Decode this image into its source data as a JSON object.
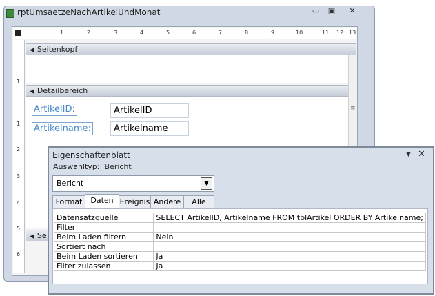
{
  "report_window": {
    "title": "rptUmsaetzeNachArtikelUndMonat",
    "buttons": {
      "minimize": "▭",
      "restore": "▣",
      "close": "✕"
    }
  },
  "ruler": {
    "top_numbers": [
      "1",
      "2",
      "3",
      "4",
      "5",
      "6",
      "7",
      "8",
      "9",
      "10",
      "11",
      "12",
      "13"
    ],
    "left_numbers": [
      "1",
      "1",
      "2",
      "3",
      "4",
      "5",
      "6"
    ]
  },
  "sections": {
    "page_header": "Seitenkopf",
    "detail": "Detailbereich",
    "page_footer_partial": "Se"
  },
  "detail_controls": [
    {
      "label": "ArtikelID:",
      "textbox": "ArtikelID"
    },
    {
      "label": "Artikelname:",
      "textbox": "Artikelname"
    }
  ],
  "property_sheet": {
    "title": "Eigenschaftenblatt",
    "selection_type_label": "Auswahltyp:",
    "selection_type_value": "Bericht",
    "object_combo_value": "Bericht",
    "tabs": [
      "Format",
      "Daten",
      "Ereignis",
      "Andere",
      "Alle"
    ],
    "active_tab": "Daten",
    "rows": [
      {
        "key": "Datensatzquelle",
        "value": "SELECT ArtikelID, Artikelname FROM tblArtikel ORDER BY Artikelname;"
      },
      {
        "key": "Filter",
        "value": ""
      },
      {
        "key": "Beim Laden filtern",
        "value": "Nein"
      },
      {
        "key": "Sortiert nach",
        "value": ""
      },
      {
        "key": "Beim Laden sortieren",
        "value": "Ja"
      },
      {
        "key": "Filter zulassen",
        "value": "Ja"
      }
    ]
  },
  "colors": {
    "label_text": "#4a88c9",
    "window_frame": "#cfd8e4",
    "property_sheet_frame": "#d7dfeb"
  }
}
